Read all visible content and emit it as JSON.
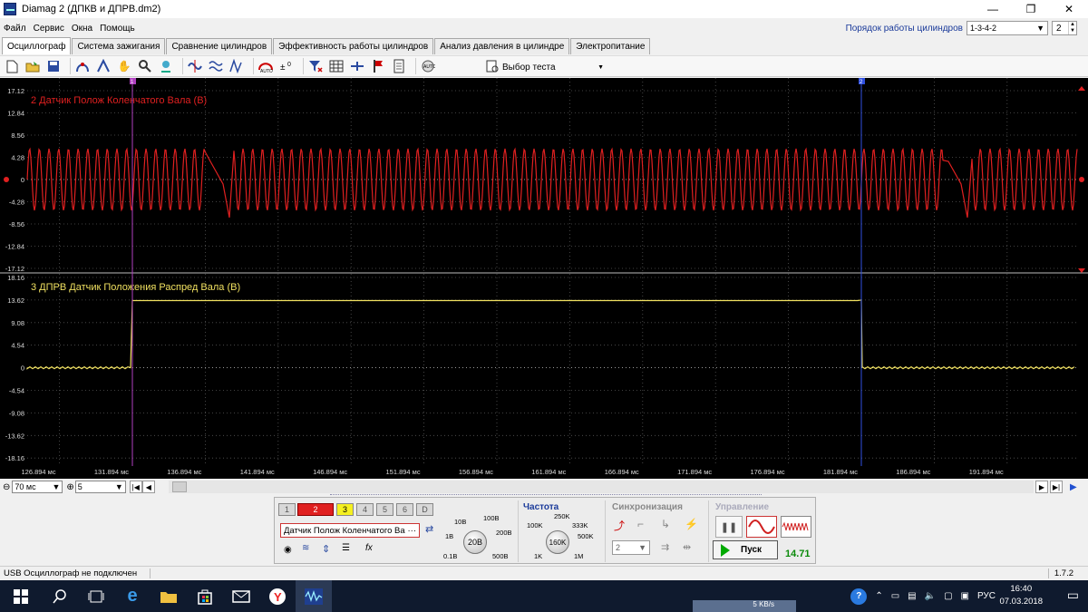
{
  "window": {
    "title": "Diamag 2 (ДПКВ и ДПРВ.dm2)",
    "min": "—",
    "max": "❐",
    "close": "✕"
  },
  "menu": [
    "Файл",
    "Сервис",
    "Окна",
    "Помощь"
  ],
  "firing_order": {
    "label": "Порядок работы цилиндров",
    "value": "1-3-4-2",
    "spin": "2"
  },
  "tabs": [
    "Осциллограф",
    "Система зажигания",
    "Сравнение цилиндров",
    "Эффективность работы цилиндров",
    "Анализ давления в цилиндре",
    "Электропитание"
  ],
  "toolbar": {
    "test_select": "Выбор теста"
  },
  "scope": {
    "cursor1_label": "1",
    "cursor2_label": "2",
    "ch2": {
      "title": "2 Датчик Полож Коленчатого Вала (В)",
      "yticks": [
        "17.12",
        "12.84",
        "8.56",
        "4.28",
        "0",
        "-4.28",
        "-8.56",
        "-12.84",
        "-17.12"
      ],
      "color": "#e02020"
    },
    "ch3": {
      "title": "3 ДПРВ Датчик Положения Распред Вала (В)",
      "yticks": [
        "18.16",
        "13.62",
        "9.08",
        "4.54",
        "0",
        "-4.54",
        "-9.08",
        "-13.62",
        "-18.16"
      ],
      "color": "#f0e060"
    },
    "xticks": [
      "126.894 мс",
      "131.894 мс",
      "136.894 мс",
      "141.894 мс",
      "146.894 мс",
      "151.894 мс",
      "156.894 мс",
      "161.894 мс",
      "166.894 мс",
      "171.894 мс",
      "176.894 мс",
      "181.894 мс",
      "186.894 мс",
      "191.894 мс"
    ]
  },
  "scroll": {
    "time": "70 мс",
    "count": "5"
  },
  "control": {
    "channels": [
      "1",
      "2",
      "3",
      "4",
      "5",
      "6",
      "D"
    ],
    "channel_name": "Датчик Полож Коленчатого Ва",
    "volt_knob": "20В",
    "volt_labels": [
      "10В",
      "100В",
      "1В",
      "200В",
      "0.1В",
      "500В"
    ],
    "freq_title": "Частота",
    "freq_knob": "160K",
    "freq_labels": [
      "250K",
      "100K",
      "333K",
      "500K",
      "1K",
      "1M"
    ],
    "sync_title": "Синхронизация",
    "sync_value": "2",
    "control_title": "Управление",
    "start": "Пуск",
    "rate": "14.71"
  },
  "status": {
    "text": "USB Осциллограф не подключен",
    "version": "1.7.2"
  },
  "taskbar": {
    "net": "5 KB/s",
    "lang": "РУС",
    "time": "16:40",
    "date": "07.03.2018"
  }
}
